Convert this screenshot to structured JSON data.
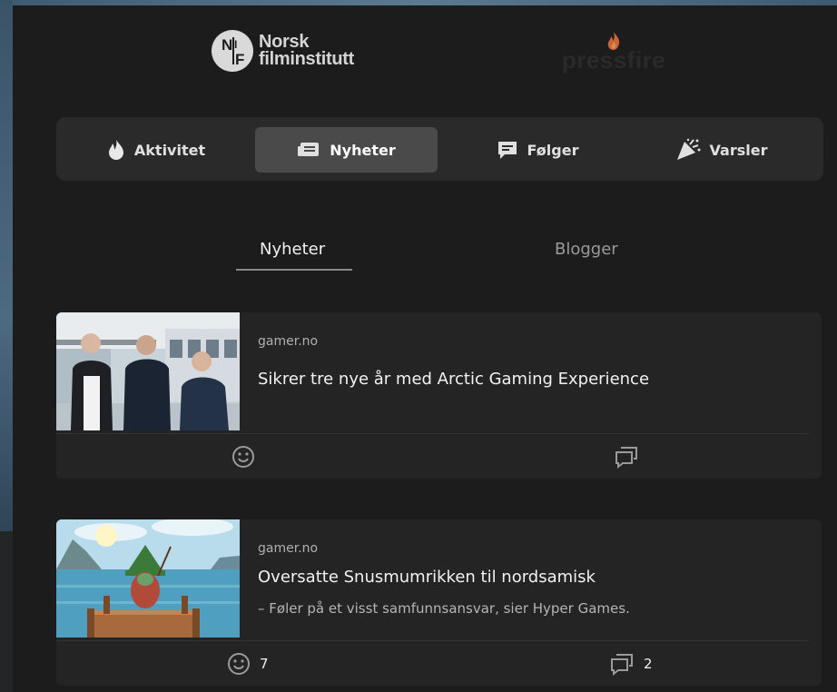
{
  "logos": {
    "nfi_line1": "Norsk",
    "nfi_line2": "filminstitutt",
    "pressfire": "pressfire"
  },
  "main_tabs": [
    {
      "label": "Aktivitet",
      "icon": "flame-icon"
    },
    {
      "label": "Nyheter",
      "icon": "newspaper-icon",
      "active": true
    },
    {
      "label": "Følger",
      "icon": "chat-icon"
    },
    {
      "label": "Varsler",
      "icon": "party-icon"
    }
  ],
  "sub_tabs": [
    {
      "label": "Nyheter",
      "active": true
    },
    {
      "label": "Blogger"
    }
  ],
  "articles": [
    {
      "source": "gamer.no",
      "title": "Sikrer tre nye år med Arctic Gaming Experience",
      "subtitle": "",
      "reactions": "",
      "comments": ""
    },
    {
      "source": "gamer.no",
      "title": "Oversatte Snusmumrikken til nordsamisk",
      "subtitle": "– Føler på et visst samfunnsansvar, sier Hyper Games.",
      "reactions": "7",
      "comments": "2"
    }
  ],
  "colors": {
    "background": "#1c1c1c",
    "tab_bar": "#2a2a2a",
    "tab_active": "#4a4a4a",
    "card": "#242424"
  }
}
